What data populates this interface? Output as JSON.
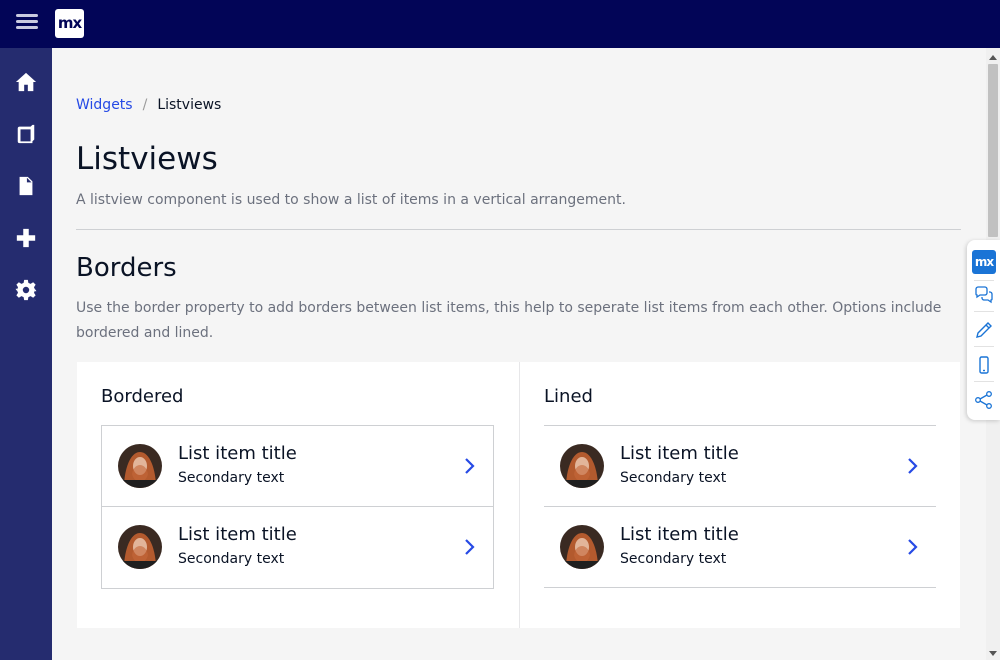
{
  "app": {
    "logo_text": "mx"
  },
  "sidebar": {
    "items": [
      {
        "name": "home"
      },
      {
        "name": "book"
      },
      {
        "name": "document"
      },
      {
        "name": "add"
      },
      {
        "name": "settings"
      }
    ]
  },
  "breadcrumb": {
    "parent": "Widgets",
    "separator": "/",
    "current": "Listviews"
  },
  "page": {
    "title": "Listviews",
    "description": "A listview component is used to show a list of items in a vertical arrangement."
  },
  "section": {
    "title": "Borders",
    "description": "Use the border property to add borders between list items, this help to seperate list items from each other. Options include bordered and lined."
  },
  "cards": [
    {
      "title": "Bordered",
      "items": [
        {
          "title": "List item title",
          "subtitle": "Secondary text"
        },
        {
          "title": "List item title",
          "subtitle": "Secondary text"
        }
      ]
    },
    {
      "title": "Lined",
      "items": [
        {
          "title": "List item title",
          "subtitle": "Secondary text"
        },
        {
          "title": "List item title",
          "subtitle": "Secondary text"
        }
      ]
    }
  ],
  "dev_panel": {
    "logo_text": "mx"
  },
  "colors": {
    "topbar": "#020557",
    "sidebar": "#252c6f",
    "link": "#264ae5",
    "chevron": "#264ae5",
    "devpanel_accent": "#1a74d6"
  }
}
